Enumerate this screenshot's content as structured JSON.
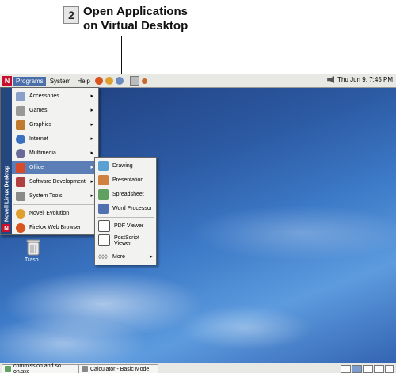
{
  "callout": {
    "number": "2",
    "line1": "Open Applications",
    "line2": "on Virtual Desktop"
  },
  "top_panel": {
    "menus": [
      "Programs",
      "System",
      "Help"
    ],
    "clock": "Thu Jun  9,  7:45 PM"
  },
  "main_menu": {
    "sidebar_label": "Novell Linux Desktop",
    "items": [
      {
        "label": "Accessories",
        "has_submenu": true
      },
      {
        "label": "Games",
        "has_submenu": true
      },
      {
        "label": "Graphics",
        "has_submenu": true
      },
      {
        "label": "Internet",
        "has_submenu": true
      },
      {
        "label": "Multimedia",
        "has_submenu": true
      },
      {
        "label": "Office",
        "has_submenu": true
      },
      {
        "label": "Software Development",
        "has_submenu": true
      },
      {
        "label": "System Tools",
        "has_submenu": true
      },
      {
        "label": "Novell Evolution",
        "has_submenu": false
      },
      {
        "label": "Firefox Web Browser",
        "has_submenu": false
      }
    ],
    "active": "Office"
  },
  "office_submenu": {
    "items": [
      "Drawing",
      "Presentation",
      "Spreadsheet",
      "Word Processor",
      "PDF Viewer",
      "PostScript Viewer",
      "More"
    ]
  },
  "desktop": {
    "trash_label": "Trash"
  },
  "taskbar": {
    "tasks": [
      "commission and so on.sxc",
      "Calculator - Basic Mode"
    ]
  },
  "colors": {
    "accent": "#5b7eb6",
    "novell_red": "#c8102e",
    "sidebar": "#24477f"
  }
}
